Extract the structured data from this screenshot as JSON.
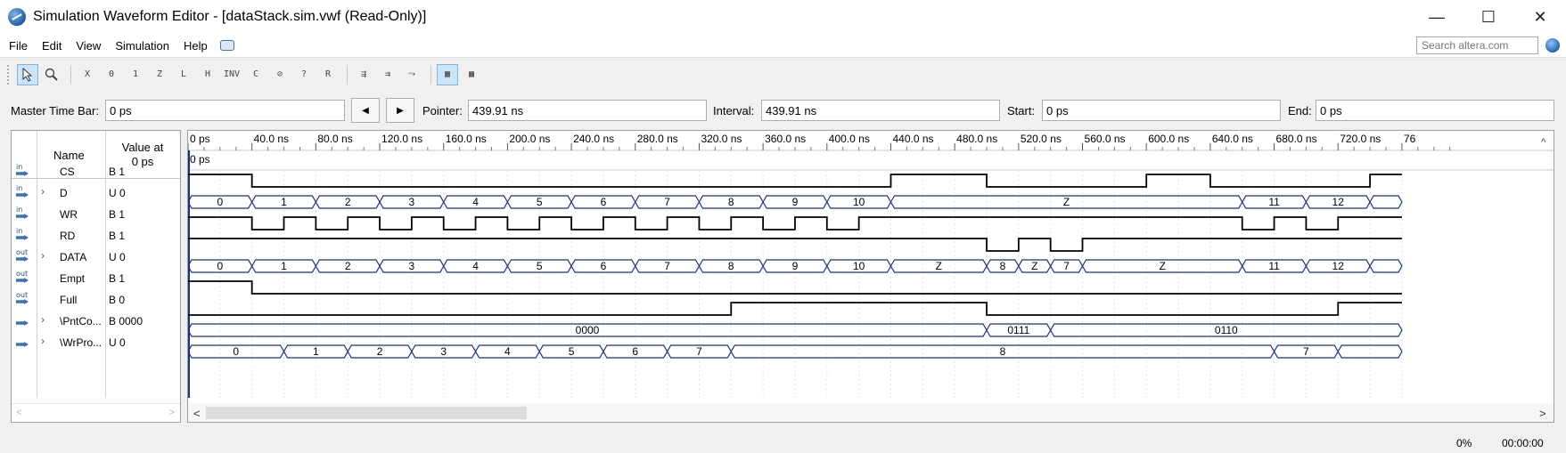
{
  "window": {
    "title": "Simulation Waveform Editor - [dataStack.sim.vwf (Read-Only)]",
    "minimize": "—",
    "maximize": "☐",
    "close": "✕"
  },
  "menu": {
    "items": [
      "File",
      "Edit",
      "View",
      "Simulation",
      "Help"
    ],
    "search_placeholder": "Search altera.com"
  },
  "toolbar": {
    "buttons": [
      "pointer",
      "zoom",
      "X",
      "0",
      "1",
      "Z",
      "L",
      "H",
      "INV",
      "C",
      "R",
      "?",
      "R",
      "snap1",
      "snap2",
      "snap3",
      "grid",
      "pattern"
    ]
  },
  "timebar": {
    "master_label": "Master Time Bar:",
    "master_value": "0 ps",
    "pointer_label": "Pointer:",
    "pointer_value": "439.91 ns",
    "interval_label": "Interval:",
    "interval_value": "439.91 ns",
    "start_label": "Start:",
    "start_value": "0 ps",
    "end_label": "End:",
    "end_value": "0 ps",
    "prev_glyph": "◀",
    "next_glyph": "▶"
  },
  "signal_list": {
    "name_header": "Name",
    "value_header_line1": "Value at",
    "value_header_line2": "0 ps",
    "signals": [
      {
        "dir": "in",
        "name": "CS",
        "value": "B 1",
        "bus": false
      },
      {
        "dir": "in",
        "name": "D",
        "value": "U 0",
        "bus": true
      },
      {
        "dir": "in",
        "name": "WR",
        "value": "B 1",
        "bus": false
      },
      {
        "dir": "in",
        "name": "RD",
        "value": "B 1",
        "bus": false
      },
      {
        "dir": "out",
        "name": "DATA",
        "value": "U 0",
        "bus": true
      },
      {
        "dir": "out",
        "name": "Empt",
        "value": "B 1",
        "bus": false
      },
      {
        "dir": "out",
        "name": "Full",
        "value": "B 0",
        "bus": false
      },
      {
        "dir": "buried",
        "name": "\\PntCo...",
        "value": "B 0000",
        "bus": true
      },
      {
        "dir": "buried",
        "name": "\\WrPro...",
        "value": "U 0",
        "bus": true
      }
    ]
  },
  "time_axis": {
    "ticks": [
      "0 ps",
      "40.0 ns",
      "80.0 ns",
      "120.0 ns",
      "160.0 ns",
      "200.0 ns",
      "240.0 ns",
      "280.0 ns",
      "320.0 ns",
      "360.0 ns",
      "400.0 ns",
      "440.0 ns",
      "480.0 ns",
      "520.0 ns",
      "560.0 ns",
      "600.0 ns",
      "640.0 ns",
      "680.0 ns",
      "720.0 ns",
      "76"
    ],
    "cursor_label": "0 ps"
  },
  "waves": {
    "CS": {
      "type": "bit",
      "edges": [
        [
          0,
          1
        ],
        [
          40,
          0
        ],
        [
          440,
          1
        ],
        [
          500,
          0
        ],
        [
          600,
          1
        ],
        [
          640,
          0
        ],
        [
          740,
          1
        ],
        [
          760,
          1
        ]
      ]
    },
    "D": {
      "type": "bus",
      "segments": [
        [
          0,
          40,
          "0"
        ],
        [
          40,
          80,
          "1"
        ],
        [
          80,
          120,
          "2"
        ],
        [
          120,
          160,
          "3"
        ],
        [
          160,
          200,
          "4"
        ],
        [
          200,
          240,
          "5"
        ],
        [
          240,
          280,
          "6"
        ],
        [
          280,
          320,
          "7"
        ],
        [
          320,
          360,
          "8"
        ],
        [
          360,
          400,
          "9"
        ],
        [
          400,
          440,
          "10"
        ],
        [
          440,
          660,
          "Z"
        ],
        [
          660,
          700,
          "11"
        ],
        [
          700,
          740,
          "12"
        ],
        [
          740,
          760,
          ""
        ]
      ]
    },
    "WR": {
      "type": "bit",
      "edges": [
        [
          0,
          1
        ],
        [
          40,
          0
        ],
        [
          60,
          1
        ],
        [
          80,
          0
        ],
        [
          100,
          1
        ],
        [
          120,
          0
        ],
        [
          140,
          1
        ],
        [
          160,
          0
        ],
        [
          180,
          1
        ],
        [
          200,
          0
        ],
        [
          220,
          1
        ],
        [
          240,
          0
        ],
        [
          260,
          1
        ],
        [
          280,
          0
        ],
        [
          300,
          1
        ],
        [
          320,
          0
        ],
        [
          340,
          1
        ],
        [
          360,
          0
        ],
        [
          380,
          1
        ],
        [
          400,
          0
        ],
        [
          420,
          1
        ],
        [
          660,
          0
        ],
        [
          680,
          1
        ],
        [
          700,
          0
        ],
        [
          720,
          1
        ],
        [
          760,
          1
        ]
      ]
    },
    "RD": {
      "type": "bit",
      "edges": [
        [
          0,
          1
        ],
        [
          500,
          0
        ],
        [
          520,
          1
        ],
        [
          540,
          0
        ],
        [
          560,
          1
        ],
        [
          760,
          1
        ]
      ]
    },
    "DATA": {
      "type": "bus",
      "segments": [
        [
          0,
          40,
          "0"
        ],
        [
          40,
          80,
          "1"
        ],
        [
          80,
          120,
          "2"
        ],
        [
          120,
          160,
          "3"
        ],
        [
          160,
          200,
          "4"
        ],
        [
          200,
          240,
          "5"
        ],
        [
          240,
          280,
          "6"
        ],
        [
          280,
          320,
          "7"
        ],
        [
          320,
          360,
          "8"
        ],
        [
          360,
          400,
          "9"
        ],
        [
          400,
          440,
          "10"
        ],
        [
          440,
          500,
          "Z"
        ],
        [
          500,
          520,
          "8"
        ],
        [
          520,
          540,
          "Z"
        ],
        [
          540,
          560,
          "7"
        ],
        [
          560,
          660,
          "Z"
        ],
        [
          660,
          700,
          "11"
        ],
        [
          700,
          740,
          "12"
        ],
        [
          740,
          760,
          ""
        ]
      ]
    },
    "Empt": {
      "type": "bit",
      "edges": [
        [
          0,
          1
        ],
        [
          40,
          0
        ],
        [
          760,
          0
        ]
      ]
    },
    "Full": {
      "type": "bit",
      "edges": [
        [
          0,
          0
        ],
        [
          340,
          1
        ],
        [
          500,
          0
        ],
        [
          720,
          1
        ],
        [
          760,
          1
        ]
      ]
    },
    "PntCo": {
      "type": "bus",
      "segments": [
        [
          0,
          500,
          "0000"
        ],
        [
          500,
          540,
          "0111"
        ],
        [
          540,
          760,
          "0110"
        ]
      ]
    },
    "WrPro": {
      "type": "bus",
      "segments": [
        [
          0,
          60,
          "0"
        ],
        [
          60,
          100,
          "1"
        ],
        [
          100,
          140,
          "2"
        ],
        [
          140,
          180,
          "3"
        ],
        [
          180,
          220,
          "4"
        ],
        [
          220,
          260,
          "5"
        ],
        [
          260,
          300,
          "6"
        ],
        [
          300,
          340,
          "7"
        ],
        [
          340,
          680,
          "8"
        ],
        [
          680,
          720,
          "7"
        ],
        [
          720,
          760,
          ""
        ]
      ]
    }
  },
  "status": {
    "percent": "0%",
    "elapsed": "00:00:00"
  }
}
